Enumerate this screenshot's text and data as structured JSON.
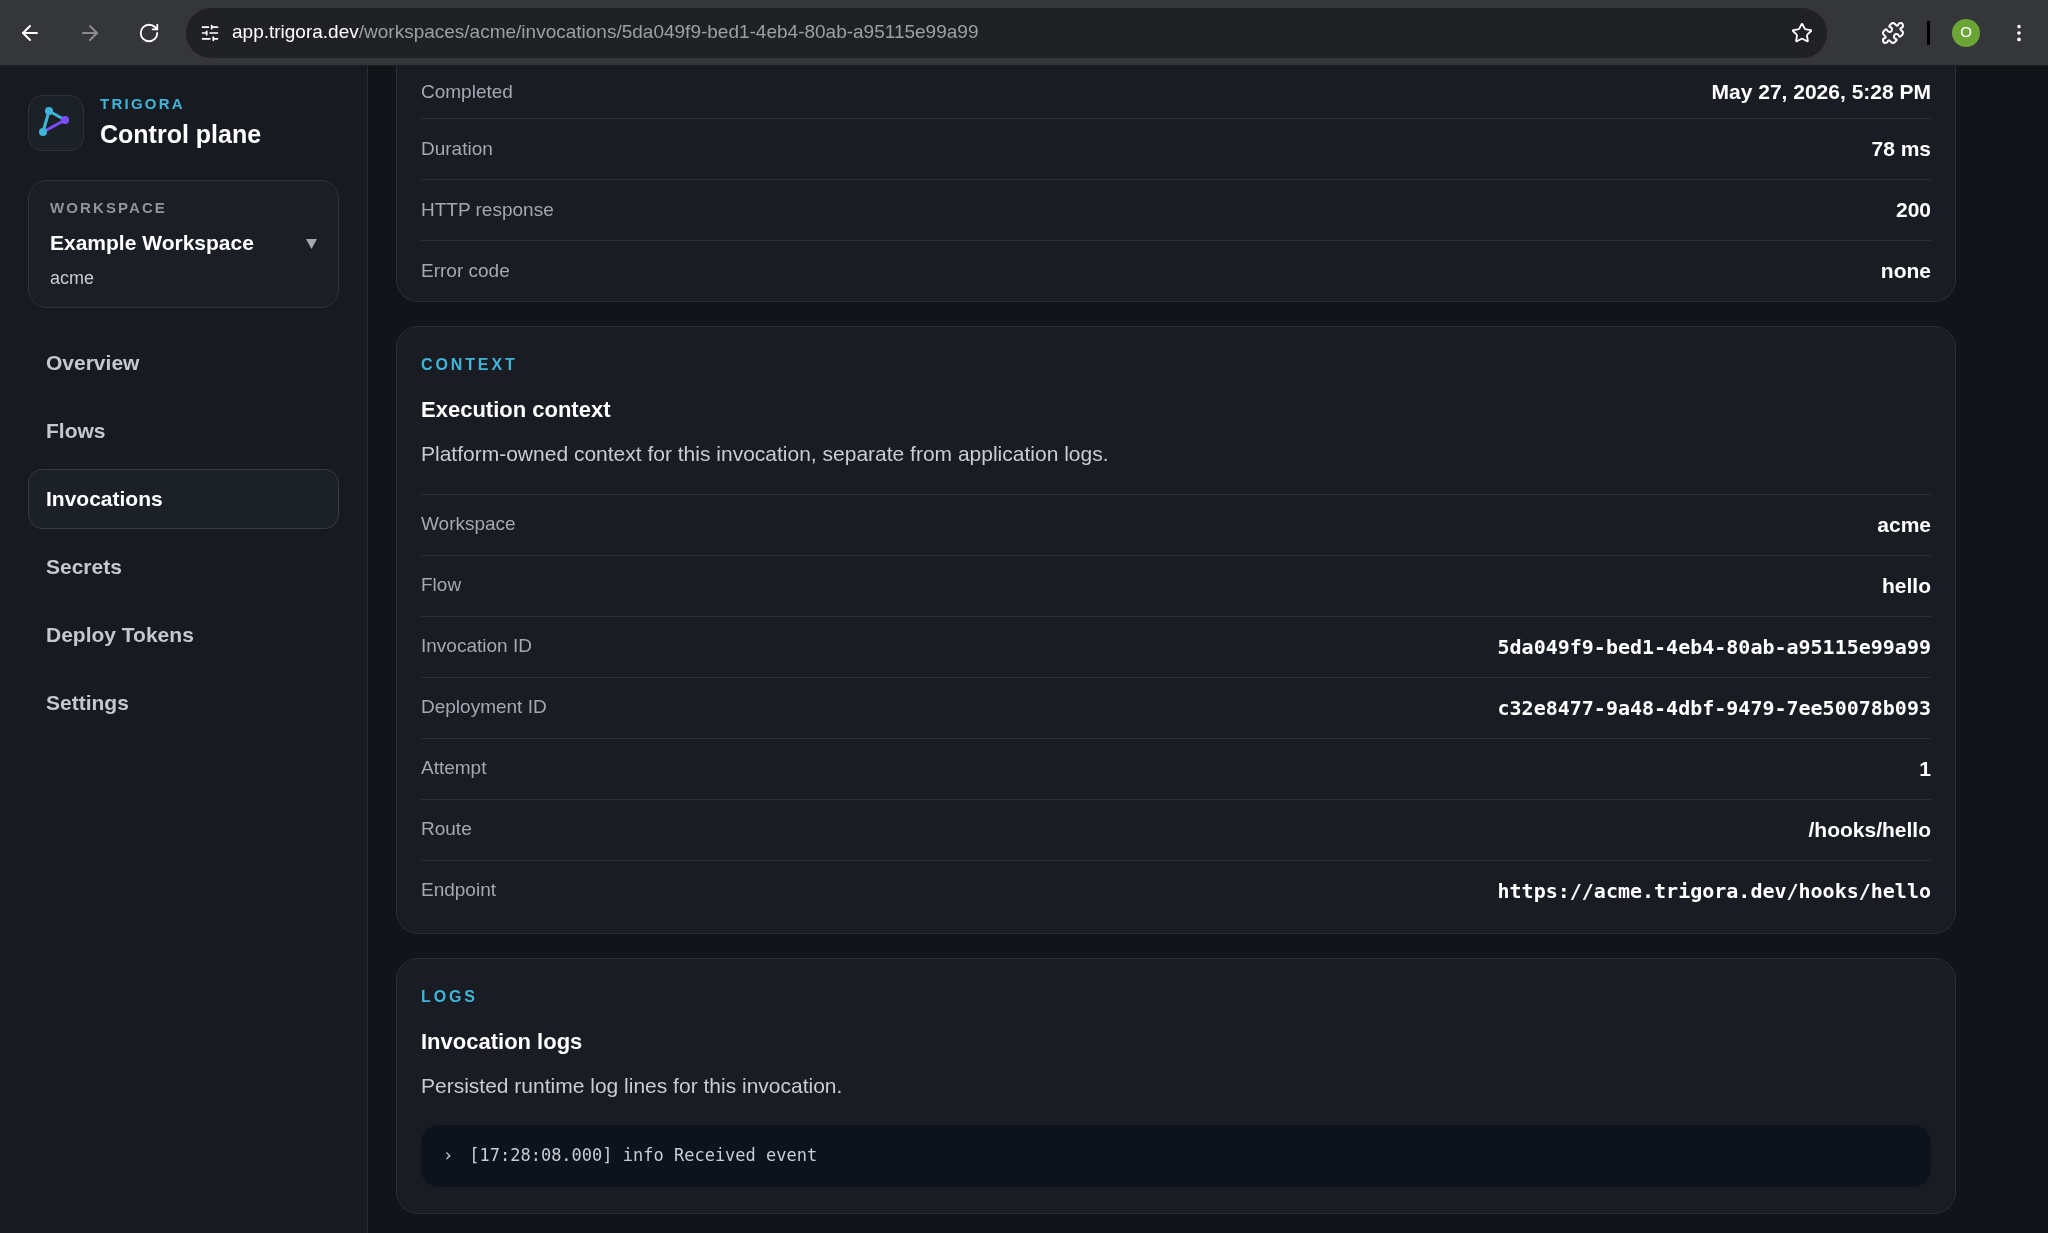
{
  "browser": {
    "url_host": "app.trigora.dev",
    "url_path": "/workspaces/acme/invocations/5da049f9-bed1-4eb4-80ab-a95115e99a99",
    "profile_initial": "O"
  },
  "brand": {
    "eyebrow": "TRIGORA",
    "title": "Control plane"
  },
  "workspace": {
    "label": "WORKSPACE",
    "name": "Example Workspace",
    "slug": "acme"
  },
  "nav": [
    {
      "label": "Overview",
      "selected": false
    },
    {
      "label": "Flows",
      "selected": false
    },
    {
      "label": "Invocations",
      "selected": true
    },
    {
      "label": "Secrets",
      "selected": false
    },
    {
      "label": "Deploy Tokens",
      "selected": false
    },
    {
      "label": "Settings",
      "selected": false
    }
  ],
  "summary_rows": [
    {
      "label": "Completed",
      "value": "May 27, 2026, 5:28 PM"
    },
    {
      "label": "Duration",
      "value": "78 ms"
    },
    {
      "label": "HTTP response",
      "value": "200"
    },
    {
      "label": "Error code",
      "value": "none"
    }
  ],
  "context": {
    "eyebrow": "CONTEXT",
    "title": "Execution context",
    "description": "Platform-owned context for this invocation, separate from application logs.",
    "rows": [
      {
        "label": "Workspace",
        "value": "acme",
        "kind": "text"
      },
      {
        "label": "Flow",
        "value": "hello",
        "kind": "text"
      },
      {
        "label": "Invocation ID",
        "value": "5da049f9-bed1-4eb4-80ab-a95115e99a99",
        "kind": "mono"
      },
      {
        "label": "Deployment ID",
        "value": "c32e8477-9a48-4dbf-9479-7ee50078b093",
        "kind": "mono"
      },
      {
        "label": "Attempt",
        "value": "1",
        "kind": "text"
      },
      {
        "label": "Route",
        "value": "/hooks/hello",
        "kind": "text"
      },
      {
        "label": "Endpoint",
        "value": "https://acme.trigora.dev/hooks/hello",
        "kind": "mono"
      }
    ]
  },
  "logs": {
    "eyebrow": "LOGS",
    "title": "Invocation logs",
    "description": "Persisted runtime log lines for this invocation.",
    "lines": [
      {
        "caret": "›",
        "text": "[17:28:08.000] info Received event"
      }
    ]
  }
}
